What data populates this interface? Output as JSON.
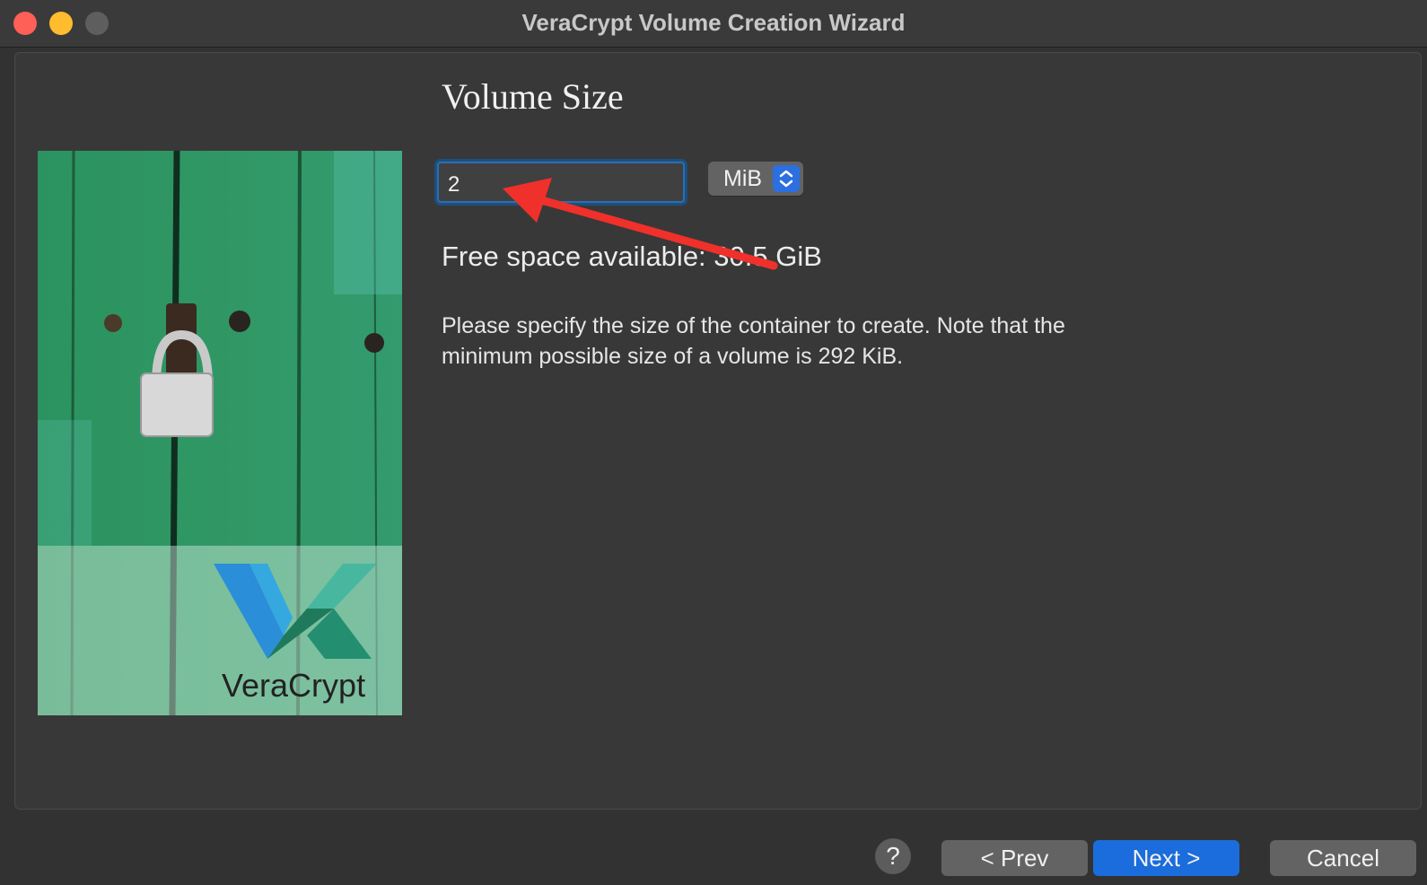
{
  "window": {
    "title": "VeraCrypt Volume Creation Wizard"
  },
  "page": {
    "heading": "Volume Size",
    "size_value": "2",
    "unit": "MiB",
    "free_space": "Free space available: 30.5 GiB",
    "description": "Please specify the size of the container to create. Note that the minimum possible size of a volume is 292 KiB."
  },
  "logo": {
    "text": "VeraCrypt"
  },
  "buttons": {
    "help": "?",
    "prev": "< Prev",
    "next": "Next >",
    "cancel": "Cancel"
  },
  "colors": {
    "accent": "#1b6cdc",
    "annotation_arrow": "#f0302a",
    "image_green": "#2e9a64"
  }
}
